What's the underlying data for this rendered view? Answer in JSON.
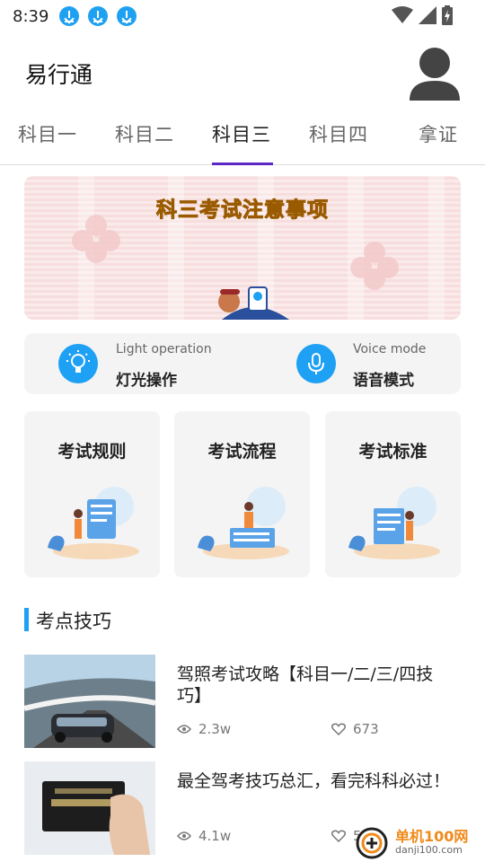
{
  "status_bar": {
    "time": "8:39",
    "notification_icons": [
      "download-icon",
      "download-icon",
      "download-icon"
    ],
    "right_icons": [
      "wifi-icon",
      "signal-icon",
      "battery-icon"
    ]
  },
  "header": {
    "app_title": "易行通",
    "avatar_icon": "person-icon"
  },
  "tabs": [
    {
      "label": "科目一",
      "active": false
    },
    {
      "label": "科目二",
      "active": false
    },
    {
      "label": "科目三",
      "active": true
    },
    {
      "label": "科目四",
      "active": false
    },
    {
      "label": "拿证",
      "active": false
    }
  ],
  "banner": {
    "title": "科三考试注意事项"
  },
  "modes": [
    {
      "subtitle": "Light operation",
      "label": "灯光操作",
      "icon": "lightbulb-icon"
    },
    {
      "subtitle": "Voice mode",
      "label": "语音模式",
      "icon": "microphone-icon"
    }
  ],
  "cards": [
    {
      "title": "考试规则"
    },
    {
      "title": "考试流程"
    },
    {
      "title": "考试标准"
    }
  ],
  "section": {
    "title": "考点技巧"
  },
  "articles": [
    {
      "title": "驾照考试攻略【科目一/二/三/四技巧】",
      "views": "2.3w",
      "likes": "673"
    },
    {
      "title": "最全驾考技巧总汇，看完科科必过！",
      "views": "4.1w",
      "likes": "50"
    }
  ],
  "watermark": {
    "name": "单机100网",
    "url": "danji100.com"
  },
  "colors": {
    "accent": "#1ea0f5",
    "tab_indicator": "#5b28c6",
    "banner_title": "#f6b400"
  }
}
